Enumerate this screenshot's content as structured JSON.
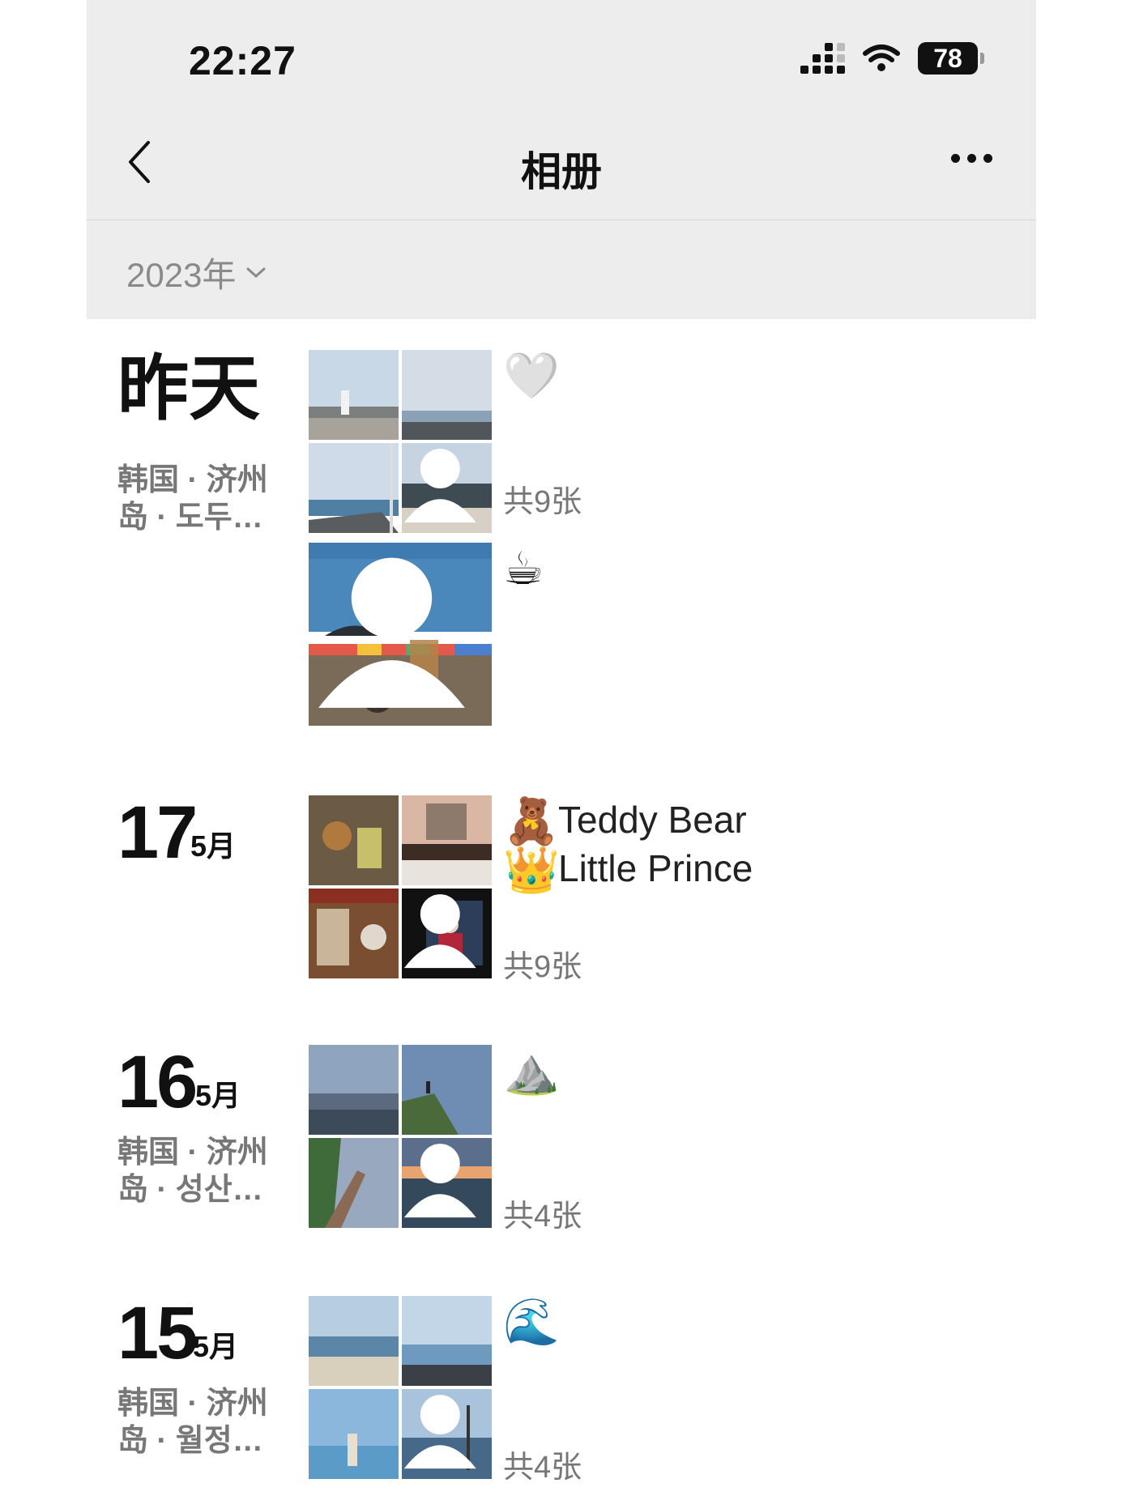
{
  "status_bar": {
    "time": "22:27",
    "battery": "78"
  },
  "nav": {
    "title": "相册"
  },
  "year_filter": "2023年",
  "days": [
    {
      "date": "昨天",
      "location_line1": "韩国 · 济州",
      "location_line2": "岛 · 도두…",
      "posts": [
        {
          "emoji": "🤍",
          "count": "共9张"
        },
        {
          "emoji": "☕"
        }
      ]
    },
    {
      "day": "17",
      "month": "5月",
      "emoji1": "🧸",
      "caption1": "Teddy Bear",
      "emoji2": "👑",
      "caption2": "Little Prince",
      "count": "共9张"
    },
    {
      "day": "16",
      "month": "5月",
      "location_line1": "韩国 · 济州",
      "location_line2": "岛 · 성산…",
      "emoji": "⛰️",
      "count": "共4张"
    },
    {
      "day": "15",
      "month": "5月",
      "location_line1": "韩国 · 济州",
      "location_line2": "岛 · 월정…",
      "emoji": "🌊",
      "count": "共4张"
    }
  ]
}
